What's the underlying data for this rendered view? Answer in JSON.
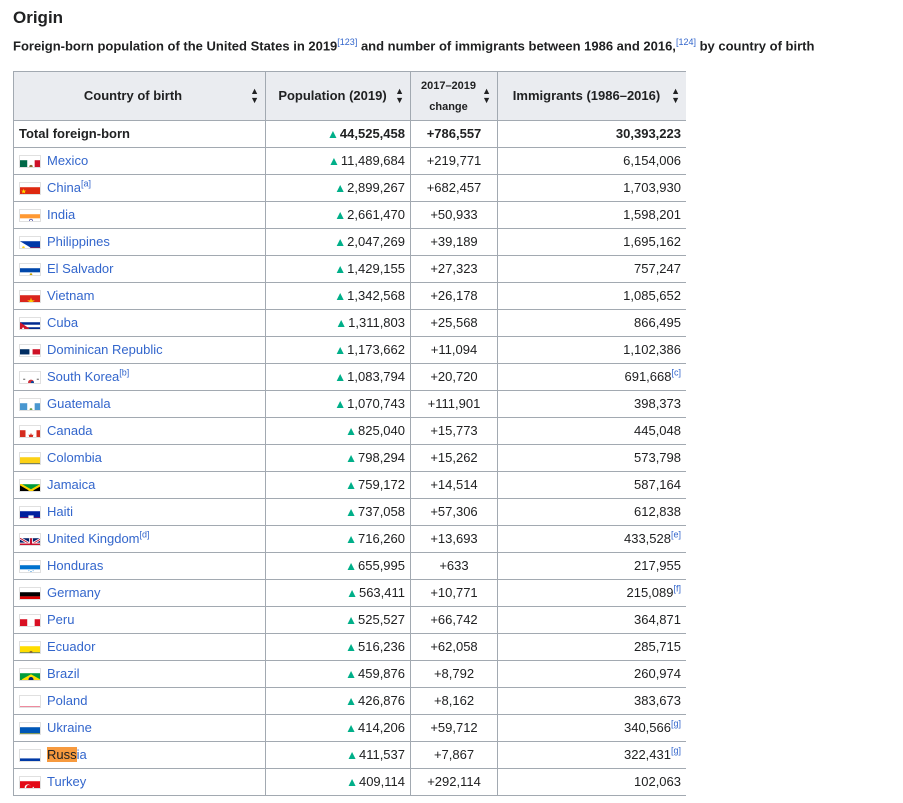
{
  "heading": "Origin",
  "caption": {
    "part1": "Foreign-born population of the United States in 2019",
    "ref1": "[123]",
    "part2": " and number of immigrants between 1986 and 2016,",
    "ref2": "[124]",
    "part3": " by country of birth"
  },
  "columns": {
    "country": "Country of birth",
    "population": "Population (2019)",
    "change_top": "2017–2019",
    "change_bottom": "change",
    "immigrants": "Immigrants (1986–2016)"
  },
  "sort_icon": "sort-icon",
  "up_icon": "triangle-up-icon",
  "rows": [
    {
      "country": "Total foreign-born",
      "note": "",
      "population": "44,525,458",
      "change": "+786,557",
      "immigrants": "30,393,223",
      "inote": "",
      "flag": ""
    },
    {
      "country": "Mexico",
      "note": "",
      "population": "11,489,684",
      "change": "+219,771",
      "immigrants": "6,154,006",
      "inote": "",
      "flag": "mexico"
    },
    {
      "country": "China",
      "note": "[a]",
      "population": "2,899,267",
      "change": "+682,457",
      "immigrants": "1,703,930",
      "inote": "",
      "flag": "china"
    },
    {
      "country": "India",
      "note": "",
      "population": "2,661,470",
      "change": "+50,933",
      "immigrants": "1,598,201",
      "inote": "",
      "flag": "india"
    },
    {
      "country": "Philippines",
      "note": "",
      "population": "2,047,269",
      "change": "+39,189",
      "immigrants": "1,695,162",
      "inote": "",
      "flag": "philippines"
    },
    {
      "country": "El Salvador",
      "note": "",
      "population": "1,429,155",
      "change": "+27,323",
      "immigrants": "757,247",
      "inote": "",
      "flag": "elsalvador"
    },
    {
      "country": "Vietnam",
      "note": "",
      "population": "1,342,568",
      "change": "+26,178",
      "immigrants": "1,085,652",
      "inote": "",
      "flag": "vietnam"
    },
    {
      "country": "Cuba",
      "note": "",
      "population": "1,311,803",
      "change": "+25,568",
      "immigrants": "866,495",
      "inote": "",
      "flag": "cuba"
    },
    {
      "country": "Dominican Republic",
      "note": "",
      "population": "1,173,662",
      "change": "+11,094",
      "immigrants": "1,102,386",
      "inote": "",
      "flag": "dominican"
    },
    {
      "country": "South Korea",
      "note": "[b]",
      "population": "1,083,794",
      "change": "+20,720",
      "immigrants": "691,668",
      "inote": "[c]",
      "flag": "southkorea"
    },
    {
      "country": "Guatemala",
      "note": "",
      "population": "1,070,743",
      "change": "+111,901",
      "immigrants": "398,373",
      "inote": "",
      "flag": "guatemala"
    },
    {
      "country": "Canada",
      "note": "",
      "population": "825,040",
      "change": "+15,773",
      "immigrants": "445,048",
      "inote": "",
      "flag": "canada"
    },
    {
      "country": "Colombia",
      "note": "",
      "population": "798,294",
      "change": "+15,262",
      "immigrants": "573,798",
      "inote": "",
      "flag": "colombia"
    },
    {
      "country": "Jamaica",
      "note": "",
      "population": "759,172",
      "change": "+14,514",
      "immigrants": "587,164",
      "inote": "",
      "flag": "jamaica"
    },
    {
      "country": "Haiti",
      "note": "",
      "population": "737,058",
      "change": "+57,306",
      "immigrants": "612,838",
      "inote": "",
      "flag": "haiti"
    },
    {
      "country": "United Kingdom",
      "note": "[d]",
      "population": "716,260",
      "change": "+13,693",
      "immigrants": "433,528",
      "inote": "[e]",
      "flag": "uk"
    },
    {
      "country": "Honduras",
      "note": "",
      "population": "655,995",
      "change": "+633",
      "immigrants": "217,955",
      "inote": "",
      "flag": "honduras"
    },
    {
      "country": "Germany",
      "note": "",
      "population": "563,411",
      "change": "+10,771",
      "immigrants": "215,089",
      "inote": "[f]",
      "flag": "germany"
    },
    {
      "country": "Peru",
      "note": "",
      "population": "525,527",
      "change": "+66,742",
      "immigrants": "364,871",
      "inote": "",
      "flag": "peru"
    },
    {
      "country": "Ecuador",
      "note": "",
      "population": "516,236",
      "change": "+62,058",
      "immigrants": "285,715",
      "inote": "",
      "flag": "ecuador"
    },
    {
      "country": "Brazil",
      "note": "",
      "population": "459,876",
      "change": "+8,792",
      "immigrants": "260,974",
      "inote": "",
      "flag": "brazil"
    },
    {
      "country": "Poland",
      "note": "",
      "population": "426,876",
      "change": "+8,162",
      "immigrants": "383,673",
      "inote": "",
      "flag": "poland"
    },
    {
      "country": "Ukraine",
      "note": "",
      "population": "414,206",
      "change": "+59,712",
      "immigrants": "340,566",
      "inote": "[g]",
      "flag": "ukraine"
    },
    {
      "country": "Russia",
      "note": "",
      "population": "411,537",
      "change": "+7,867",
      "immigrants": "322,431",
      "inote": "[g]",
      "flag": "russia",
      "highlight_part": "Russ",
      "rest_part": "ia"
    },
    {
      "country": "Turkey",
      "note": "",
      "population": "409,114",
      "change": "+292,114",
      "immigrants": "102,063",
      "inote": "",
      "flag": "turkey"
    }
  ],
  "colors": {
    "link": "#3366cc",
    "header_bg": "#eaecf0",
    "border": "#a2a9b1",
    "up_triangle": "#00af89",
    "highlight": "#f79a3e"
  }
}
